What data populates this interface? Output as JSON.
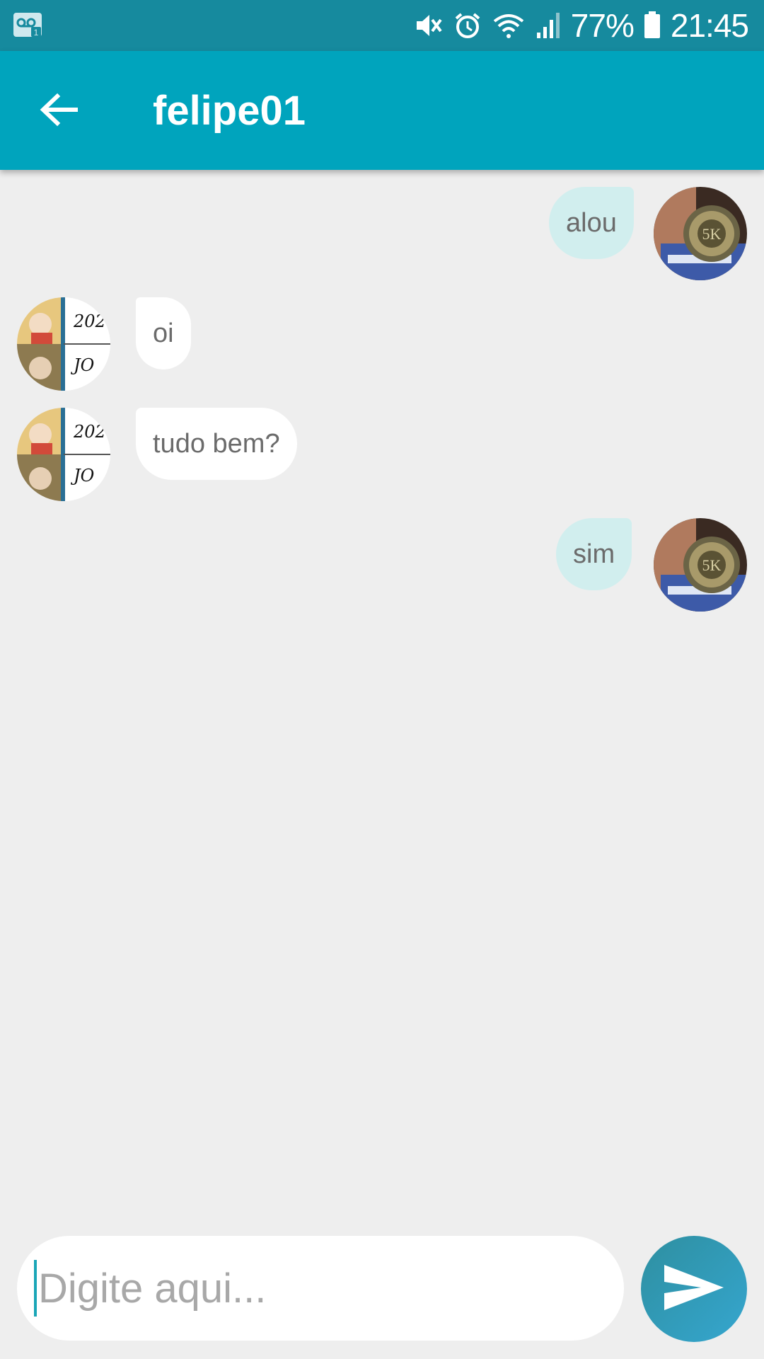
{
  "status_bar": {
    "battery_percent": "77%",
    "time": "21:45",
    "icons": [
      "voicemail-icon",
      "vibrate-muted-icon",
      "alarm-icon",
      "wifi-icon",
      "signal-icon",
      "battery-icon"
    ]
  },
  "header": {
    "back_icon": "arrow-left-icon",
    "title": "felipe01"
  },
  "messages": [
    {
      "direction": "outgoing",
      "text": "alou",
      "avatar": "medal-photo-avatar"
    },
    {
      "direction": "incoming",
      "text": "oi",
      "avatar": "anime-collage-avatar"
    },
    {
      "direction": "incoming",
      "text": "tudo bem?",
      "avatar": "anime-collage-avatar"
    },
    {
      "direction": "outgoing",
      "text": "sim",
      "avatar": "medal-photo-avatar"
    }
  ],
  "composer": {
    "placeholder": "Digite aqui...",
    "value": "",
    "send_icon": "send-icon"
  },
  "colors": {
    "status_bar": "#168a9e",
    "app_bar": "#00a4bd",
    "background": "#eeeeee",
    "outgoing_bubble": "#d1eeee",
    "incoming_bubble": "#ffffff",
    "send_button": "#2e9cb8"
  }
}
